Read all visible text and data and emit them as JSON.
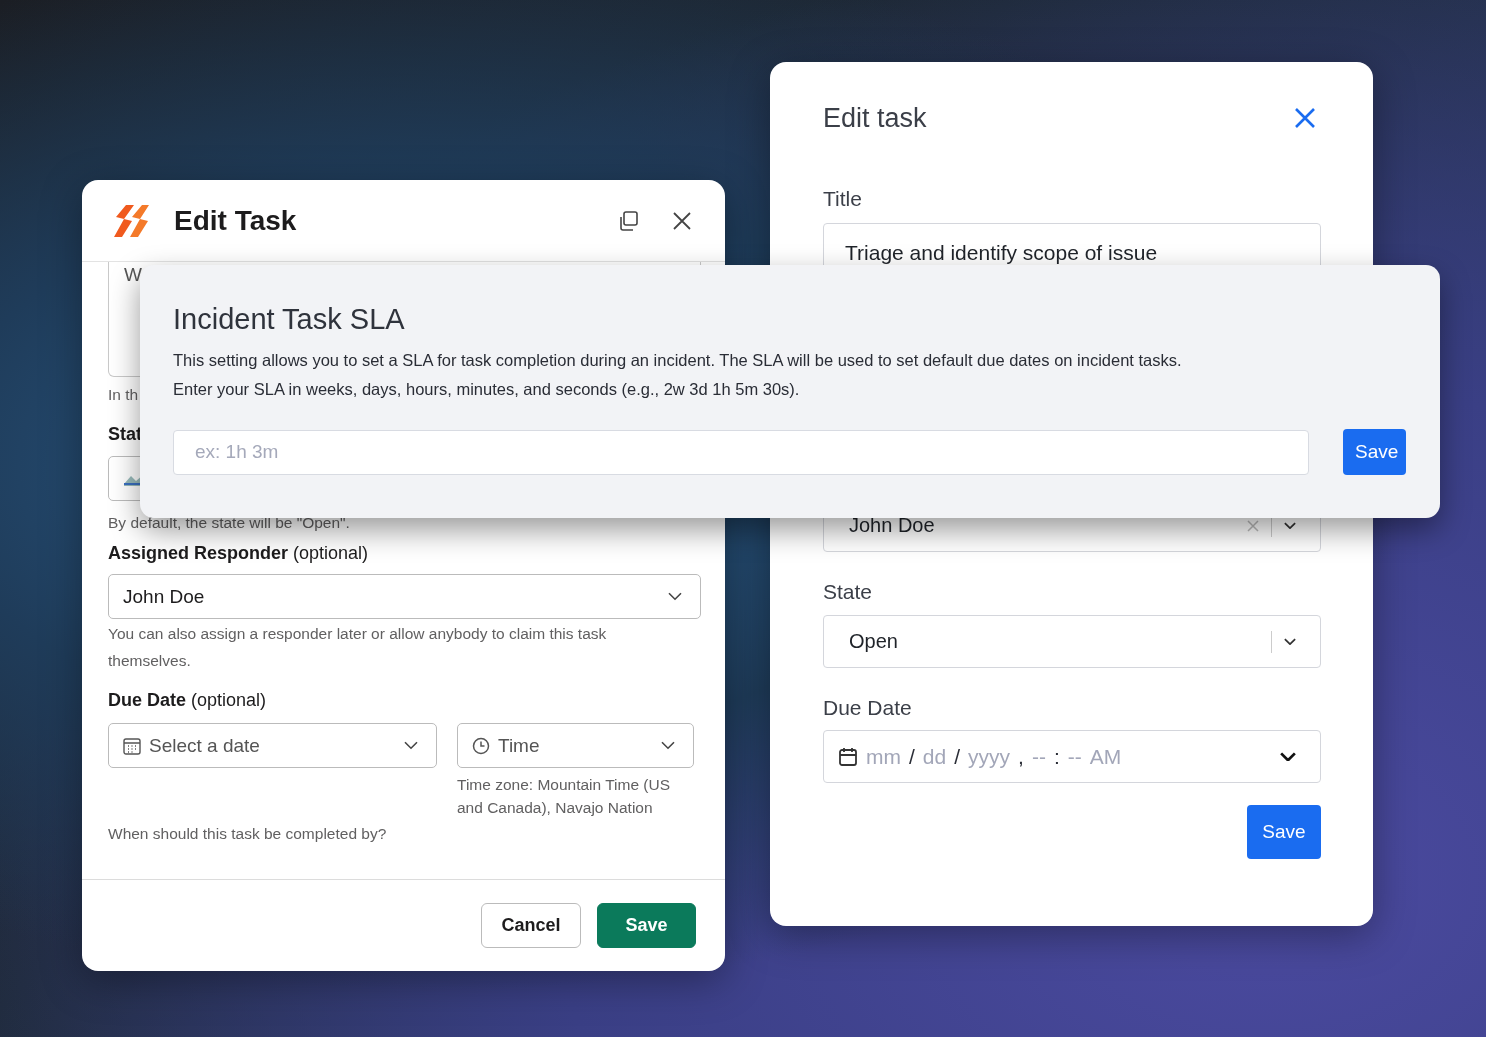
{
  "left_dialog": {
    "title": "Edit Task",
    "description_value": "W",
    "description_hint": "In th",
    "state_label": "Stat",
    "state_hint": "By default, the state will be \"Open\".",
    "responder": {
      "label": "**Assigned Responder** (optional)",
      "value": "John Doe",
      "hint": "You can also assign a responder later or allow anybody to claim this task themselves."
    },
    "due_date": {
      "label": "**Due Date** (optional)",
      "date_label": "Select a date",
      "time_label": "Time",
      "time_zone": "Time zone: Mountain Time (US and Canada), Navajo Nation",
      "hint": "When should this task be completed by?"
    },
    "buttons": [
      {
        "label": "Cancel",
        "kind": "secondary"
      },
      {
        "label": "Save",
        "kind": "primary"
      }
    ]
  },
  "right_dialog": {
    "title": "Edit task",
    "title_label": "Title",
    "title_value": "Triage and identify scope of issue",
    "responder_value": "John Doe",
    "state_label": "State",
    "state_value": "Open",
    "due_label": "Due Date",
    "date_segments": [
      {
        "text": "mm",
        "kind": "placeholder"
      },
      {
        "text": "/",
        "kind": "separator"
      },
      {
        "text": "dd",
        "kind": "placeholder"
      },
      {
        "text": "/",
        "kind": "separator"
      },
      {
        "text": "yyyy",
        "kind": "placeholder"
      },
      {
        "text": ",",
        "kind": "separator"
      },
      {
        "text": "--",
        "kind": "placeholder"
      },
      {
        "text": ":",
        "kind": "separator"
      },
      {
        "text": "--",
        "kind": "placeholder"
      },
      {
        "text": "AM",
        "kind": "placeholder"
      }
    ],
    "save": "Save"
  },
  "sla_dialog": {
    "title": "Incident Task SLA",
    "lines": [
      "This setting allows you to set a SLA for task completion during an incident. The SLA will be used to set default due dates on incident tasks.",
      "Enter your SLA in weeks, days, hours, minutes, and seconds (e.g., 2w 3d 1h 5m 30s)."
    ],
    "placeholder": "ex: 1h 3m",
    "save": "Save"
  }
}
